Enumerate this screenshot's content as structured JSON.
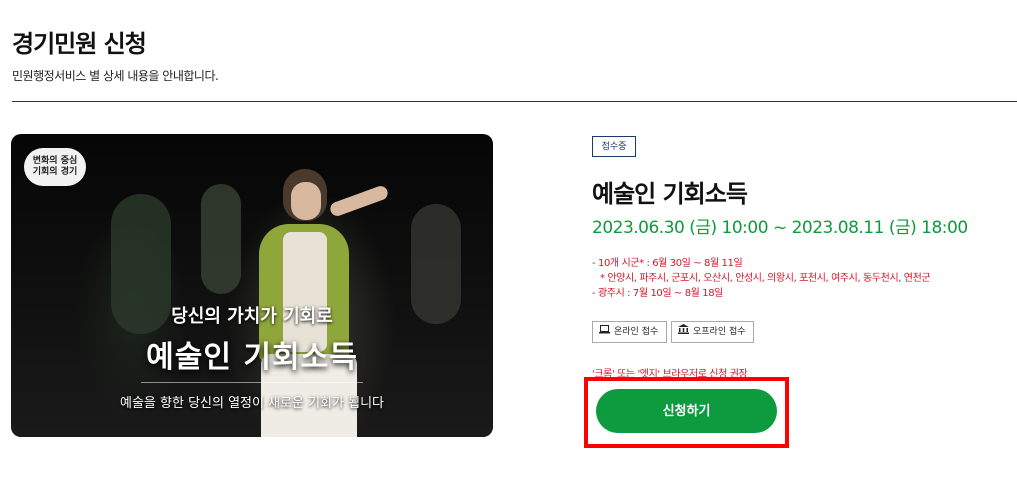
{
  "header": {
    "title": "경기민원 신청",
    "description": "민원행정서비스 별 상세 내용을 안내합니다."
  },
  "banner": {
    "badge_line1": "변화의 중심",
    "badge_line2": "기회의 경기",
    "line1": "당신의 가치가 기회로",
    "line2": "예술인 기회소득",
    "line3": "예술을 향한 당신의 열정이 새로운 기회가 됩니다"
  },
  "service": {
    "status": "접수중",
    "title": "예술인 기회소득",
    "period": "2023.06.30 (금) 10:00 ~ 2023.08.11 (금) 18:00",
    "notice_lines": [
      "- 10개 시군* : 6월 30일 ~ 8월 11일",
      "* 안양시, 파주시, 군포시, 오산시, 안성시, 의왕시, 포천시, 여주시, 동두천시, 연천군",
      "- 광주시 : 7월 10일 ~ 8월 18일"
    ],
    "channels": {
      "online": "온라인 접수",
      "offline": "오프라인 접수"
    },
    "browser_note": "'크롬' 또는 '엣지' 브라우저로 신청 권장",
    "apply_label": "신청하기"
  },
  "colors": {
    "accent_green": "#0e9a3e",
    "notice_red": "#d8142b",
    "highlight_red": "#ff0000",
    "navy": "#1c3a6a"
  },
  "icons": {
    "online": "laptop-icon",
    "offline": "building-icon"
  }
}
